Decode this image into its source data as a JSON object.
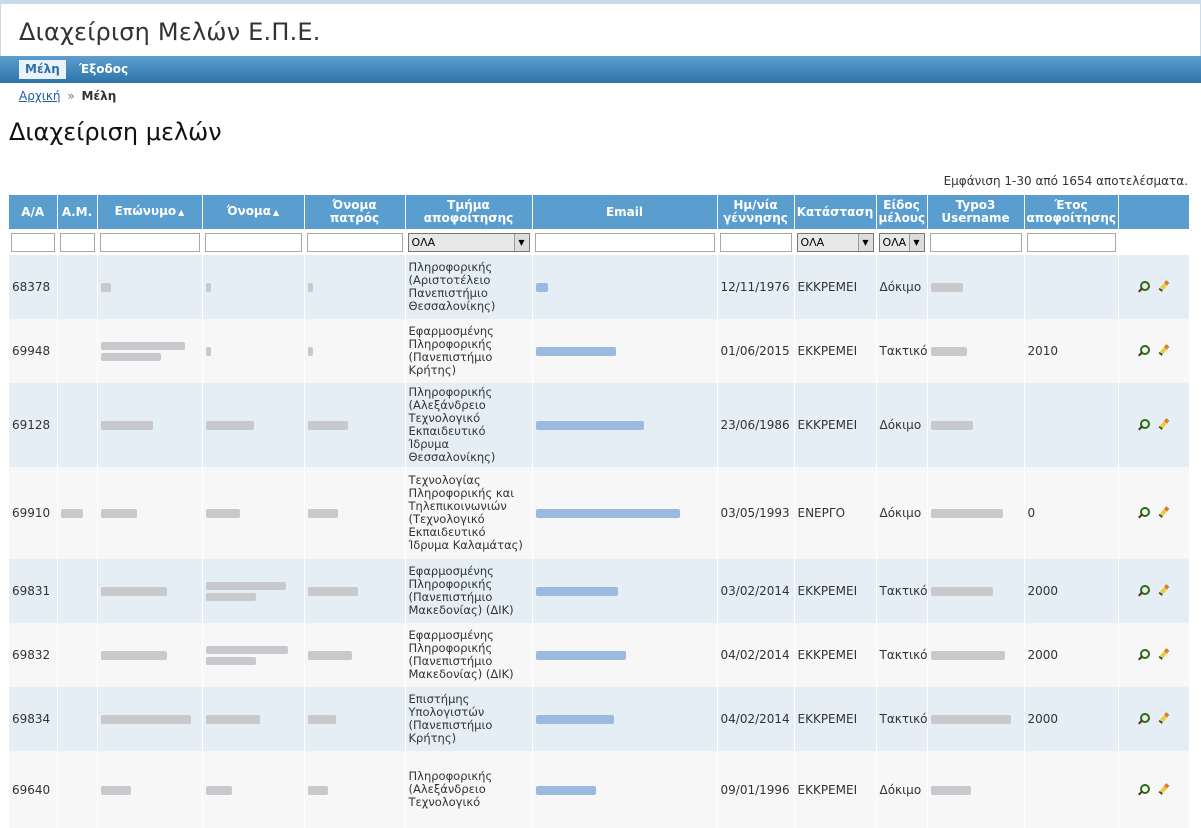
{
  "app": {
    "title": "Διαχείριση Μελών Ε.Π.Ε."
  },
  "menu": {
    "items": [
      {
        "label": "Μέλη",
        "active": true
      },
      {
        "label": "Έξοδος",
        "active": false
      }
    ]
  },
  "breadcrumb": {
    "home": "Αρχική",
    "separator": "»",
    "current": "Μέλη"
  },
  "page": {
    "title": "Διαχείριση μελών",
    "summary": "Εμφάνιση 1-30 από 1654 αποτελέσματα."
  },
  "table": {
    "headers": {
      "aa": "Α/Α",
      "am": "Α.Μ.",
      "surname": "Επώνυμο",
      "name": "Όνομα",
      "father": "Όνομα πατρός",
      "dept": "Τμήμα αποφοίτησης",
      "email": "Email",
      "birth": "Ημ/νία γέννησης",
      "status": "Κατάσταση",
      "type": "Είδος μέλους",
      "typo3": "Typo3 Username",
      "year": "Έτος αποφοίτησης"
    },
    "sort_marker": "▲",
    "filters": {
      "dept": "ΟΛΑ",
      "status": "ΟΛΑ",
      "type": "ΟΛΑ"
    },
    "rows": [
      {
        "aa": "68378",
        "dept": "Πληροφορικής (Αριστοτέλειο Πανεπιστήμιο Θεσσαλονίκης)",
        "birth": "12/11/1976",
        "status": "ΕΚΚΡΕΜΕΙ",
        "type": "Δόκιμο",
        "year": ""
      },
      {
        "aa": "69948",
        "dept": "Εφαρμοσμένης Πληροφορικής (Πανεπιστήμιο Κρήτης)",
        "birth": "01/06/2015",
        "status": "ΕΚΚΡΕΜΕΙ",
        "type": "Τακτικό",
        "year": "2010"
      },
      {
        "aa": "69128",
        "dept": "Πληροφορικής (Αλεξάνδρειο Τεχνολογικό Εκπαιδευτικό Ίδρυμα Θεσσαλονίκης)",
        "birth": "23/06/1986",
        "status": "ΕΚΚΡΕΜΕΙ",
        "type": "Δόκιμο",
        "year": ""
      },
      {
        "aa": "69910",
        "dept": "Τεχνολογίας Πληροφορικής και Τηλεπικοινωνιών (Τεχνολογικό Εκπαιδευτικό Ίδρυμα Καλαμάτας)",
        "birth": "03/05/1993",
        "status": "ΕΝΕΡΓΟ",
        "type": "Δόκιμο",
        "year": "0"
      },
      {
        "aa": "69831",
        "dept": "Εφαρμοσμένης Πληροφορικής (Πανεπιστήμιο Μακεδονίας) (ΔΙΚ)",
        "birth": "03/02/2014",
        "status": "ΕΚΚΡΕΜΕΙ",
        "type": "Τακτικό",
        "year": "2000"
      },
      {
        "aa": "69832",
        "dept": "Εφαρμοσμένης Πληροφορικής (Πανεπιστήμιο Μακεδονίας) (ΔΙΚ)",
        "birth": "04/02/2014",
        "status": "ΕΚΚΡΕΜΕΙ",
        "type": "Τακτικό",
        "year": "2000"
      },
      {
        "aa": "69834",
        "dept": "Επιστήμης Υπολογιστών (Πανεπιστήμιο Κρήτης)",
        "birth": "04/02/2014",
        "status": "ΕΚΚΡΕΜΕΙ",
        "type": "Τακτικό",
        "year": "2000"
      },
      {
        "aa": "69640",
        "dept": "Πληροφορικής (Αλεξάνδρειο Τεχνολογικό",
        "birth": "09/01/1996",
        "status": "ΕΚΚΡΕΜΕΙ",
        "type": "Δόκιμο",
        "year": ""
      }
    ]
  }
}
